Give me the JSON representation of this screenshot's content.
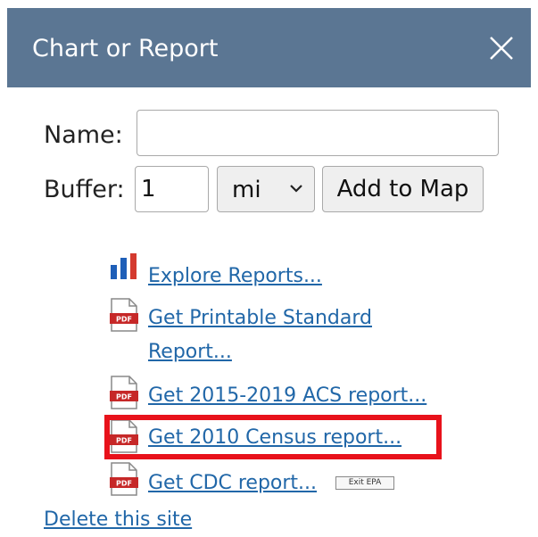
{
  "panel": {
    "title": "Chart or Report",
    "close_icon": "close-icon",
    "header_color": "#5b7693"
  },
  "form": {
    "name_label": "Name:",
    "name_value": "",
    "buffer_label": "Buffer:",
    "buffer_value": "1",
    "unit_selected": "mi",
    "add_button": "Add to Map"
  },
  "reports": [
    {
      "label": "Explore Reports...",
      "icon": "bar-chart-icon"
    },
    {
      "label_line1": "Get Printable Standard",
      "label_line2": "Report...",
      "icon": "pdf-icon"
    },
    {
      "label": "Get 2015-2019 ACS report...",
      "icon": "pdf-icon"
    },
    {
      "label": "Get 2010 Census report...",
      "icon": "pdf-icon",
      "highlighted": true
    },
    {
      "label": "Get CDC report...",
      "icon": "pdf-icon",
      "badge": "Exit EPA"
    }
  ],
  "delete_link": "Delete this site",
  "colors": {
    "link": "#2167a8",
    "highlight": "#e8121b"
  }
}
